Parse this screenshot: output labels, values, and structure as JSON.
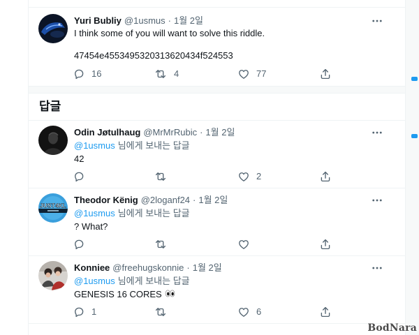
{
  "colors": {
    "text": "#0f1419",
    "secondary": "#536471",
    "accent": "#1d9bf0",
    "border": "#eff3f4",
    "band": "#f7f9f9"
  },
  "icons": {
    "reply": "reply-icon",
    "retweet": "retweet-icon",
    "like": "heart-icon",
    "share": "share-icon",
    "more": "more-icon"
  },
  "main_tweet": {
    "avatar_icon": "avatar-yuri-bubliy",
    "name": "Yuri Bubliy",
    "handle": "@1usmus",
    "dot": "·",
    "date": "1월 2일",
    "text": "I think some of you will want to solve this riddle.",
    "code": "47454e4553495320313620434f524553",
    "actions": {
      "replies": "16",
      "retweets": "4",
      "likes": "77"
    }
  },
  "replies_heading": "답글",
  "replies": [
    {
      "avatar_icon": "avatar-odin-jotulhaug",
      "name": "Odin Jøtulhaug",
      "handle": "@MrMrRubic",
      "dot": "·",
      "date": "1월 2일",
      "reply_to_handle": "@1usmus",
      "reply_to_suffix": "님에게 보내는 답글",
      "text": "42",
      "actions": {
        "likes": "2"
      }
    },
    {
      "avatar_icon": "avatar-theodor-kenig",
      "avatar_text": "JUST4KL",
      "name": "Theodor Kënig",
      "handle": "@2loganf24",
      "dot": "·",
      "date": "1월 2일",
      "reply_to_handle": "@1usmus",
      "reply_to_suffix": "님에게 보내는 답글",
      "text": "? What?",
      "actions": {}
    },
    {
      "avatar_icon": "avatar-konniee",
      "name": "Konniee",
      "handle": "@freehugskonnie",
      "dot": "·",
      "date": "1월 2일",
      "reply_to_handle": "@1usmus",
      "reply_to_suffix": "님에게 보내는 답글",
      "text": "GENESIS 16 CORES",
      "text_emoji_icon": "eyes-emoji-icon",
      "actions": {
        "replies": "1",
        "likes": "6"
      }
    }
  ],
  "watermark": "BodNara"
}
